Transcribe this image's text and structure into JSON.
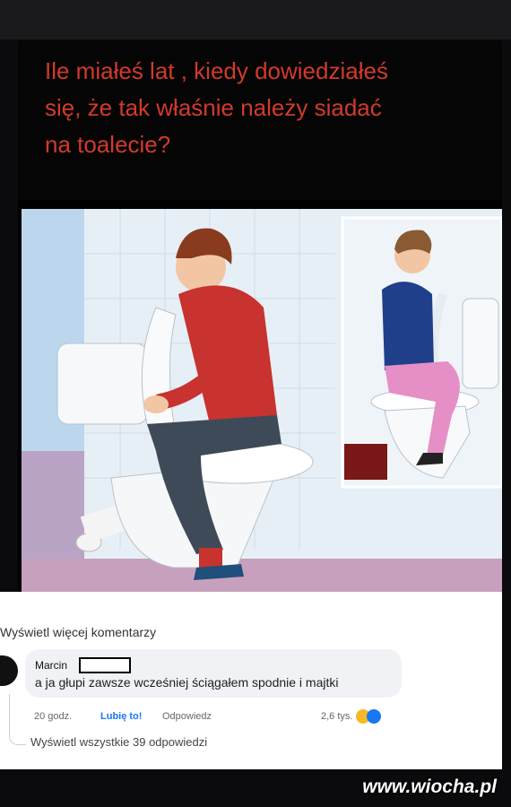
{
  "meme": {
    "title": "Ile miałeś lat , kiedy dowiedziałeś\nsię, że tak właśnie należy siadać\nna toalecie?"
  },
  "comments": {
    "view_more": "Wyświetl więcej komentarzy",
    "comment": {
      "author": "Marcin",
      "text": "a ja głupi zawsze wcześniej ściągałem spodnie i majtki",
      "time": "20 godz.",
      "like_label": "Lubię to!",
      "reply_label": "Odpowiedz",
      "reaction_count": "2,6 tys."
    },
    "view_replies": "Wyświetl wszystkie 39 odpowiedzi"
  },
  "watermark": "www.wiocha.pl",
  "colors": {
    "title_red": "#d23a2a",
    "like_blue": "#1877f2"
  }
}
